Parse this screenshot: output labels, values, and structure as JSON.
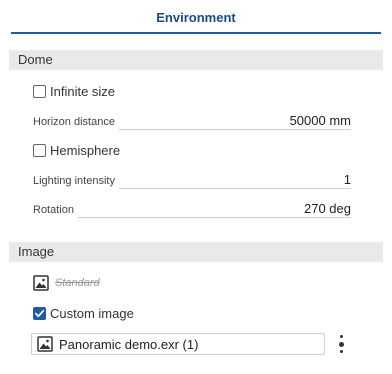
{
  "panel": {
    "title": "Environment"
  },
  "dome": {
    "header": "Dome",
    "infinite_size": {
      "label": "Infinite size",
      "checked": false
    },
    "horizon_distance": {
      "label": "Horizon distance",
      "value": "50000 mm"
    },
    "hemisphere": {
      "label": "Hemisphere",
      "checked": false
    },
    "lighting_intensity": {
      "label": "Lighting intensity",
      "value": "1"
    },
    "rotation": {
      "label": "Rotation",
      "value": "270 deg"
    }
  },
  "image": {
    "header": "Image",
    "standard": {
      "label": "Standard",
      "icon": "image-icon"
    },
    "custom_image": {
      "label": "Custom image",
      "checked": true
    },
    "file": {
      "name": "Panoramic demo.exr (1)",
      "icon": "image-icon"
    },
    "menu_icon": "vertical-ellipsis-icon"
  },
  "colors": {
    "accent": "#1f5aa8",
    "title": "#1a4a8c",
    "section_bg": "#e9e9e9"
  }
}
